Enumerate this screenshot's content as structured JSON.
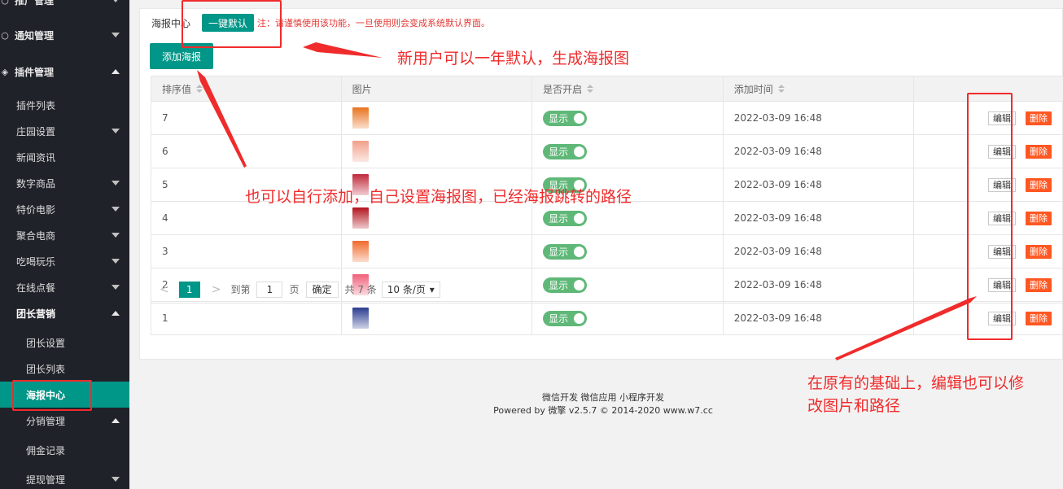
{
  "sidebar": {
    "items": [
      {
        "label": "推广管理",
        "level": "top",
        "icon": "circle-icon",
        "caret": "down"
      },
      {
        "label": "通知管理",
        "level": "top",
        "icon": "circle-icon",
        "caret": "down"
      },
      {
        "label": "插件管理",
        "level": "top",
        "icon": "cube-icon",
        "caret": "up"
      },
      {
        "label": "插件列表",
        "level": "sub"
      },
      {
        "label": "庄园设置",
        "level": "sub",
        "caret": "down"
      },
      {
        "label": "新闻资讯",
        "level": "sub"
      },
      {
        "label": "数字商品",
        "level": "sub",
        "caret": "down"
      },
      {
        "label": "特价电影",
        "level": "sub",
        "caret": "down"
      },
      {
        "label": "聚合电商",
        "level": "sub",
        "caret": "down"
      },
      {
        "label": "吃喝玩乐",
        "level": "sub",
        "caret": "down"
      },
      {
        "label": "在线点餐",
        "level": "sub",
        "caret": "down"
      },
      {
        "label": "团长营销",
        "level": "sub-bold",
        "caret": "up"
      },
      {
        "label": "团长设置",
        "level": "subsub"
      },
      {
        "label": "团长列表",
        "level": "subsub"
      },
      {
        "label": "海报中心",
        "level": "subsub",
        "active": true
      },
      {
        "label": "分销管理",
        "level": "subsub-bold",
        "caret": "up"
      },
      {
        "label": "佣金记录",
        "level": "subsub"
      },
      {
        "label": "提现管理",
        "level": "subsub-bold",
        "caret": "down"
      }
    ]
  },
  "header": {
    "breadcrumb": "海报中心",
    "default_button": "一键默认",
    "warning": "注：请谨慎使用该功能，一旦使用则会变成系统默认界面。",
    "add_button": "添加海报"
  },
  "table": {
    "columns": [
      "排序值",
      "图片",
      "是否开启",
      "添加时间",
      ""
    ],
    "rows": [
      {
        "sort": "7",
        "toggle": "显示",
        "time": "2022-03-09 16:48",
        "thumb_color": "#e8731f"
      },
      {
        "sort": "6",
        "toggle": "显示",
        "time": "2022-03-09 16:48",
        "thumb_color": "#f1a08a"
      },
      {
        "sort": "5",
        "toggle": "显示",
        "time": "2022-03-09 16:48",
        "thumb_color": "#c0283a"
      },
      {
        "sort": "4",
        "toggle": "显示",
        "time": "2022-03-09 16:48",
        "thumb_color": "#b3141e"
      },
      {
        "sort": "3",
        "toggle": "显示",
        "time": "2022-03-09 16:48",
        "thumb_color": "#f06a2c"
      },
      {
        "sort": "2",
        "toggle": "显示",
        "time": "2022-03-09 16:48",
        "thumb_color": "#f0617a"
      },
      {
        "sort": "1",
        "toggle": "显示",
        "time": "2022-03-09 16:48",
        "thumb_color": "#2a3b8f"
      }
    ],
    "edit_label": "编辑",
    "delete_label": "删除"
  },
  "pager": {
    "prev": "<",
    "current": "1",
    "next": ">",
    "goto_label": "到第",
    "goto_value": "1",
    "page_unit": "页",
    "confirm": "确定",
    "total": "共 7 条",
    "page_size": "10 条/页"
  },
  "footer": {
    "links": "微信开发 微信应用 小程序开发",
    "powered": "Powered by 微擎 v2.5.7 © 2014-2020 www.w7.cc"
  },
  "annotations": {
    "note1": "新用户可以一年默认，生成海报图",
    "note2": "也可以自行添加，自己设置海报图，已经海报跳转的路径",
    "note3_line1": "在原有的基础上，编辑也可以修",
    "note3_line2": "改图片和路径"
  },
  "colors": {
    "sidebar_bg": "#20222a",
    "accent": "#009688",
    "toggle_on": "#5fb878",
    "danger": "#ff5722",
    "annotation_red": "#f02b2b"
  }
}
